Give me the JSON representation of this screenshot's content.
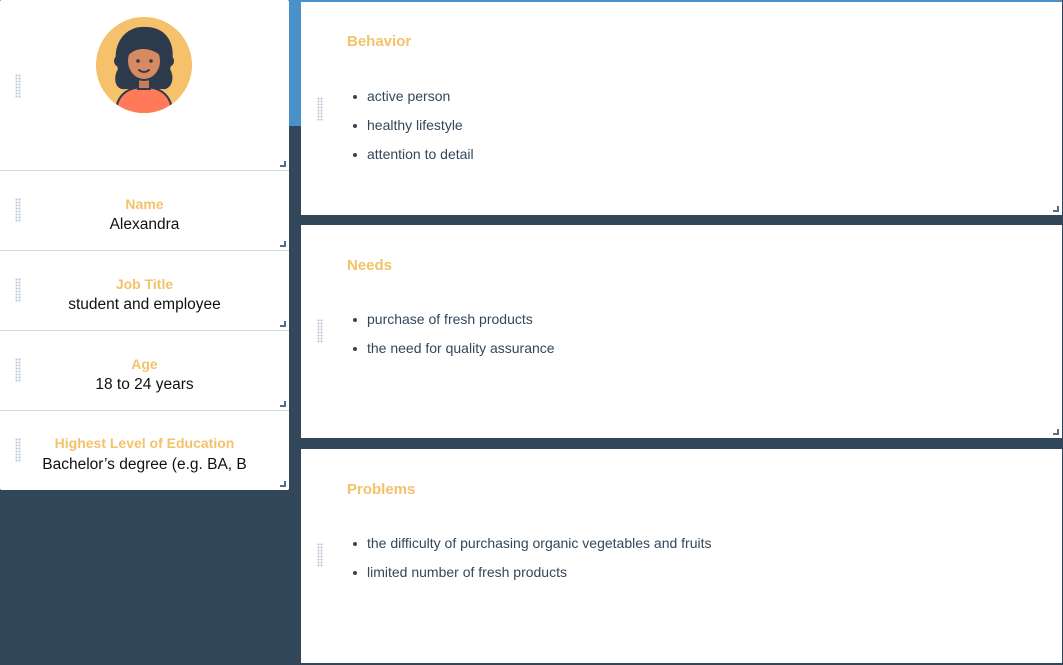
{
  "profile": {
    "avatar_icon": "woman-avatar-icon",
    "fields": [
      {
        "label": "Name",
        "value": "Alexandra"
      },
      {
        "label": "Job Title",
        "value": "student and employee"
      },
      {
        "label": "Age",
        "value": "18 to 24 years"
      },
      {
        "label": "Highest Level of Education",
        "value": "Bachelor’s degree (e.g. BA, B"
      }
    ]
  },
  "cards": [
    {
      "title": "Behavior",
      "items": [
        "active person",
        "healthy lifestyle",
        "attention to detail"
      ]
    },
    {
      "title": "Needs",
      "items": [
        "purchase of fresh products",
        "the need for quality assurance"
      ]
    },
    {
      "title": "Problems",
      "items": [
        "the difficulty of purchasing organic vegetables and fruits",
        "limited number of fresh products"
      ]
    }
  ],
  "colors": {
    "background": "#33475b",
    "label": "#f5c26b",
    "accent": "#4a90c9",
    "text": "#33475b"
  }
}
